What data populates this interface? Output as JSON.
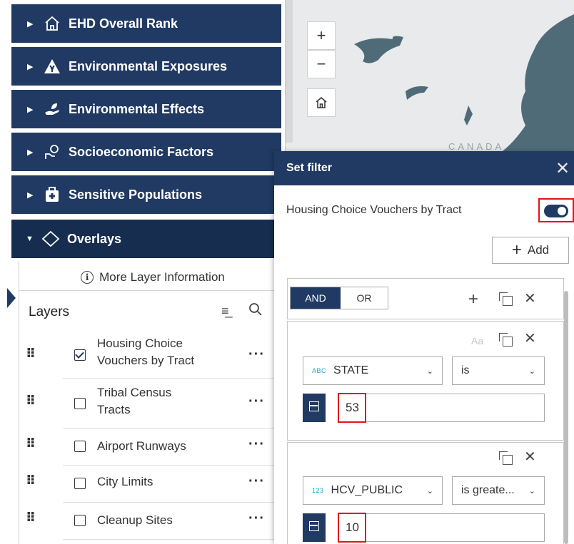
{
  "accordion": [
    {
      "label": "EHD Overall Rank",
      "icon": "home-icon",
      "expanded": false
    },
    {
      "label": "Environmental Exposures",
      "icon": "hazard-icon",
      "expanded": false
    },
    {
      "label": "Environmental Effects",
      "icon": "hand-leaf-icon",
      "expanded": false
    },
    {
      "label": "Socioeconomic Factors",
      "icon": "money-hand-icon",
      "expanded": false
    },
    {
      "label": "Sensitive Populations",
      "icon": "medkit-icon",
      "expanded": false
    },
    {
      "label": "Overlays",
      "icon": "layers-icon",
      "expanded": true
    }
  ],
  "overlays": {
    "more_info": "More Layer Information",
    "layers_title": "Layers",
    "layers": [
      {
        "name_line1": "Housing Choice",
        "name_line2": "Vouchers by Tract",
        "checked": true
      },
      {
        "name_line1": "Tribal Census",
        "name_line2": "Tracts",
        "checked": false
      },
      {
        "name_line1": "Airport Runways",
        "name_line2": "",
        "checked": false
      },
      {
        "name_line1": "City Limits",
        "name_line2": "",
        "checked": false
      },
      {
        "name_line1": "Cleanup Sites",
        "name_line2": "",
        "checked": false
      }
    ],
    "more_glyph": "···"
  },
  "map": {
    "zoom_in": "+",
    "zoom_out": "−",
    "label_canada": "CANADA",
    "colors": {
      "land": "#4f6b78",
      "water": "#e9eaec"
    }
  },
  "filter": {
    "title": "Set filter",
    "layer_name": "Housing Choice Vouchers by Tract",
    "toggle_on": true,
    "add_label": "Add",
    "logic": {
      "and": "AND",
      "or": "OR",
      "selected": "AND"
    },
    "expressions": [
      {
        "field_type": "ABC",
        "field": "STATE",
        "operator": "is",
        "value": "53"
      },
      {
        "field_type": "123",
        "field": "HCV_PUBLIC",
        "operator": "is greate...",
        "value": "10"
      }
    ],
    "case_label": "Aa"
  },
  "colors": {
    "navy": "#213a63",
    "highlight_red": "#e0151b"
  }
}
